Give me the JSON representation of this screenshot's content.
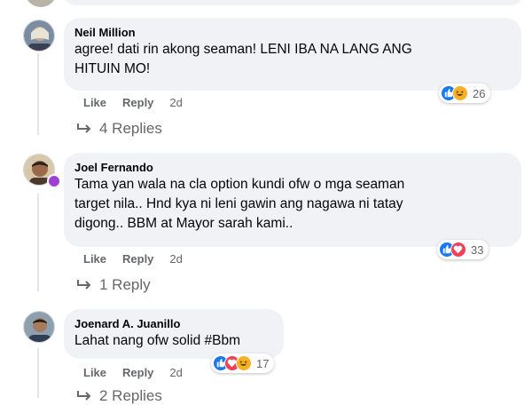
{
  "comments": [
    {
      "author": "Neil Million",
      "text_lines": [
        "agree! dati rin akong seaman! LENI IBA NA LANG ANG",
        "HITUIN MO!"
      ],
      "actions": {
        "like": "Like",
        "reply": "Reply",
        "time": "2d"
      },
      "reaction_count": "26",
      "reaction_icons": [
        "like-icon",
        "haha-icon"
      ],
      "replies_label": "4 Replies"
    },
    {
      "author": "Joel Fernando",
      "text_lines": [
        "Tama yan wala na cla option kundi ofw o mga seaman",
        "target nila.. Hnd kya ni leni gawin ang nagawa ni tatay",
        "digong.. BBM at Mayor sarah kami.."
      ],
      "actions": {
        "like": "Like",
        "reply": "Reply",
        "time": "2d"
      },
      "reaction_count": "33",
      "reaction_icons": [
        "like-icon",
        "love-icon"
      ],
      "replies_label": "1 Reply"
    },
    {
      "author": "Joenard A. Juanillo",
      "text_lines": [
        "Lahat nang ofw solid #Bbm"
      ],
      "actions": {
        "like": "Like",
        "reply": "Reply",
        "time": "2d"
      },
      "reaction_count": "17",
      "reaction_icons": [
        "like-icon",
        "love-icon",
        "haha-icon"
      ],
      "replies_label": "2 Replies"
    }
  ],
  "colors": {
    "bubble": "#f0f2f5",
    "secondary_text": "#65676b",
    "like_blue": "#1877f2",
    "love_red": "#f33e58",
    "haha_yellow": "#f7b125"
  }
}
